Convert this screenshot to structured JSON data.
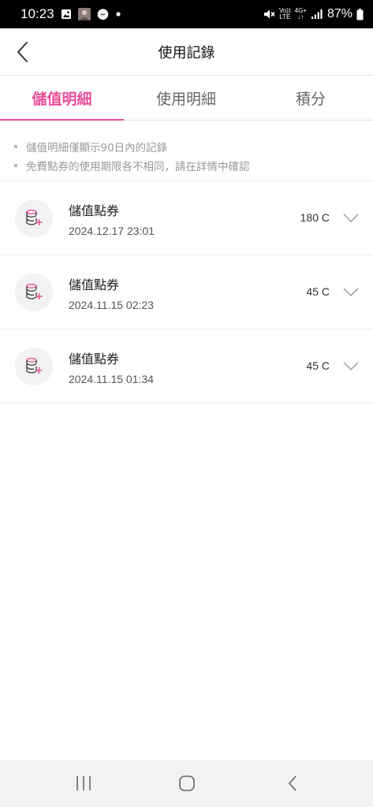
{
  "status_bar": {
    "time": "10:23",
    "battery": "87%",
    "volte_label_1": "Vo))",
    "volte_label_2": "LTE",
    "net_label_1": "4G+",
    "net_label_2": "↓↑",
    "icons": [
      "gallery-icon",
      "avatar-icon",
      "messenger-icon",
      "dot-icon",
      "mute-icon",
      "signal-icon",
      "battery-icon"
    ]
  },
  "header": {
    "title": "使用記錄"
  },
  "tabs": [
    {
      "label": "儲值明細",
      "active": true
    },
    {
      "label": "使用明細",
      "active": false
    },
    {
      "label": "積分",
      "active": false
    }
  ],
  "notes": [
    "儲值明細僅顯示90日內的記錄",
    "免費點券的使用期限各不相同，請在詳情中確認"
  ],
  "records": [
    {
      "title": "儲值點券",
      "date": "2024.12.17 23:01",
      "amount": "180 C"
    },
    {
      "title": "儲值點券",
      "date": "2024.11.15 02:23",
      "amount": "45 C"
    },
    {
      "title": "儲值點券",
      "date": "2024.11.15 01:34",
      "amount": "45 C"
    }
  ],
  "colors": {
    "accent": "#e94e9a",
    "status_bar_bg": "#000000",
    "nav_bar_bg": "#f2f2f5"
  }
}
